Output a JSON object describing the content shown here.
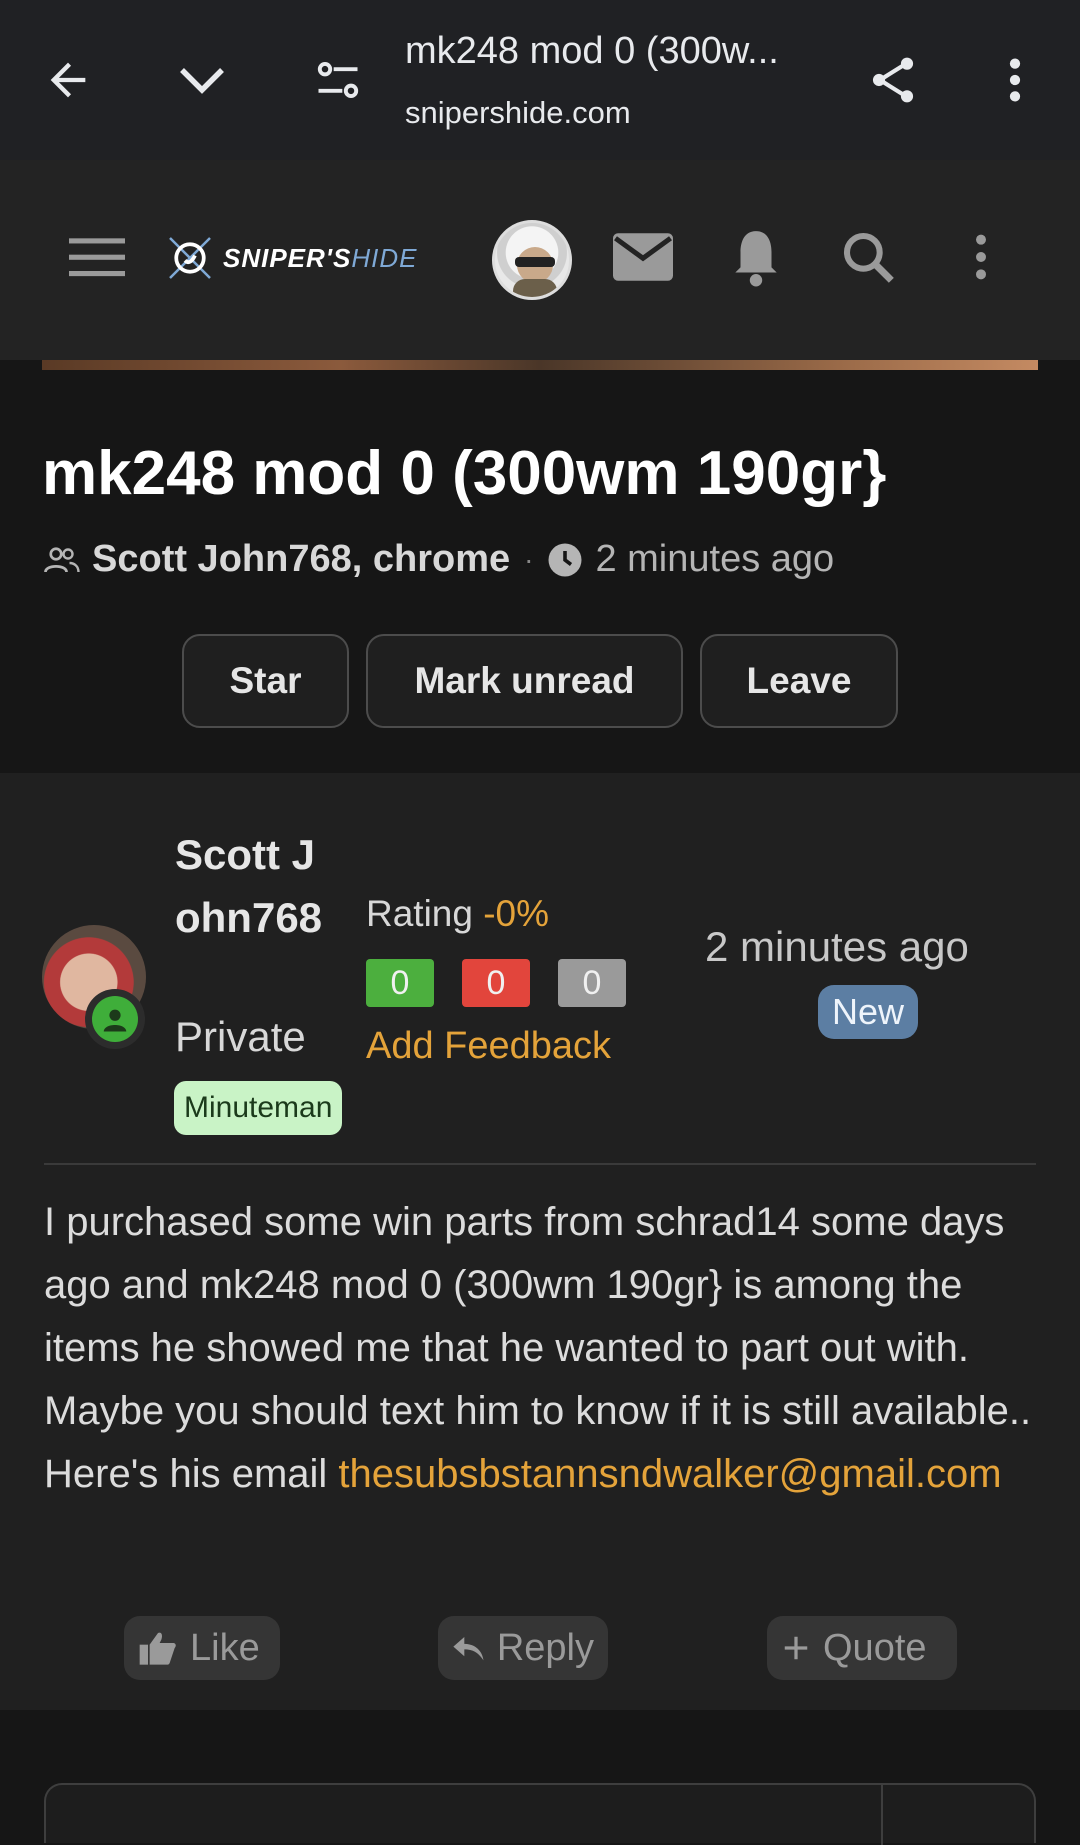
{
  "browser": {
    "tab_title": "mk248 mod 0 (300w...",
    "domain": "snipershide.com",
    "icons": [
      "back-arrow-icon",
      "chevron-down-icon",
      "site-settings-icon",
      "share-icon",
      "more-vert-icon"
    ]
  },
  "site": {
    "logo_main": "SNIPER'S",
    "logo_hide": "HIDE",
    "icons": [
      "menu-icon",
      "mail-icon",
      "bell-icon",
      "search-icon",
      "more-vert-icon"
    ]
  },
  "thread": {
    "title": "mk248 mod 0 (300wm 190gr}",
    "participants": "Scott John768, chrome",
    "separator": "·",
    "time": "2 minutes ago",
    "buttons": {
      "star": "Star",
      "mark_unread": "Mark unread",
      "leave": "Leave"
    }
  },
  "post": {
    "author": "Scott John768",
    "rank": "Private",
    "badge": "Minuteman",
    "rating_label": "Rating",
    "rating_value": "-0%",
    "feedback": {
      "positive": "0",
      "negative": "0",
      "neutral": "0",
      "colors": {
        "positive": "#4caf3e",
        "negative": "#e2453c",
        "neutral": "#9a9a9a"
      }
    },
    "add_feedback": "Add Feedback",
    "time": "2 minutes ago",
    "new_badge": "New",
    "body": "I purchased some win parts from schrad14 some days ago and mk248 mod 0 (300wm 190gr} is among the items he showed me that he wanted to part out with. Maybe you should text him to know if it is still available.. Here's his email",
    "email": "thesubsbstannsndwalker@gmail.com",
    "actions": {
      "like": "Like",
      "reply": "Reply",
      "quote": "Quote"
    }
  },
  "colors": {
    "accent": "#e4a33a",
    "background": "#161616",
    "post_bg": "#202020",
    "new_badge": "#5c7ea3"
  }
}
